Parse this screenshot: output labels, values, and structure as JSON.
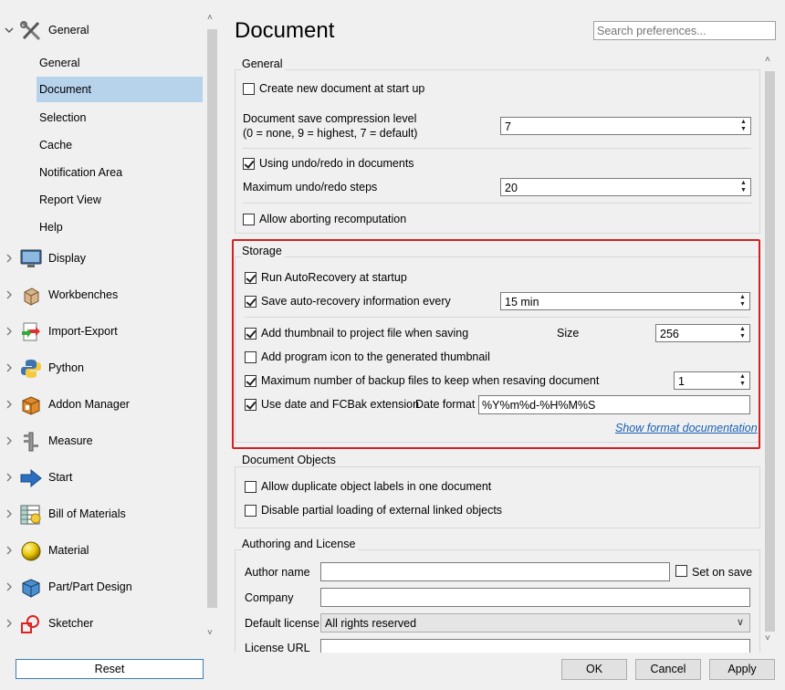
{
  "tree": {
    "top_items": [
      {
        "label": "General",
        "icon": "tools-icon",
        "expanded": true
      },
      {
        "label": "Display",
        "icon": "monitor-icon"
      },
      {
        "label": "Workbenches",
        "icon": "box-icon"
      },
      {
        "label": "Import-Export",
        "icon": "import-export-icon"
      },
      {
        "label": "Python",
        "icon": "python-icon"
      },
      {
        "label": "Addon Manager",
        "icon": "addon-box-icon"
      },
      {
        "label": "Measure",
        "icon": "caliper-icon"
      },
      {
        "label": "Start",
        "icon": "arrow-right-icon"
      },
      {
        "label": "Bill of Materials",
        "icon": "spreadsheet-icon"
      },
      {
        "label": "Material",
        "icon": "sphere-icon"
      },
      {
        "label": "Part/Part Design",
        "icon": "cube-icon"
      },
      {
        "label": "Sketcher",
        "icon": "sketch-icon"
      }
    ],
    "sub_items": [
      "General",
      "Document",
      "Selection",
      "Cache",
      "Notification Area",
      "Report View",
      "Help"
    ],
    "selected_sub": "Document",
    "reset_label": "Reset"
  },
  "page": {
    "title": "Document",
    "search_placeholder": "Search preferences..."
  },
  "general": {
    "title": "General",
    "create_new_doc": {
      "label": "Create new document at start up",
      "checked": false
    },
    "compression_label_1": "Document save compression level",
    "compression_label_2": "(0 = none, 9 = highest, 7 = default)",
    "compression_value": "7",
    "undo_redo": {
      "label": "Using undo/redo in documents",
      "checked": true
    },
    "max_undo_label": "Maximum undo/redo steps",
    "max_undo_value": "20",
    "allow_abort": {
      "label": "Allow aborting recomputation",
      "checked": false
    }
  },
  "storage": {
    "title": "Storage",
    "run_autorecovery": {
      "label": "Run AutoRecovery at startup",
      "checked": true
    },
    "save_autorecovery": {
      "label": "Save auto-recovery information every",
      "checked": true
    },
    "autorecovery_value": "15 min",
    "add_thumbnail": {
      "label": "Add thumbnail to project file when saving",
      "checked": true
    },
    "size_label": "Size",
    "size_value": "256",
    "add_program_icon": {
      "label": "Add program icon to the generated thumbnail",
      "checked": false
    },
    "max_backup": {
      "label": "Maximum number of backup files to keep when resaving document",
      "checked": true
    },
    "max_backup_value": "1",
    "use_date": {
      "label": "Use date and FCBak extension",
      "checked": true
    },
    "date_format_label": "Date format",
    "date_format_value": "%Y%m%d-%H%M%S",
    "show_doc_link": "Show format documentation"
  },
  "doc_objects": {
    "title": "Document Objects",
    "allow_duplicate": {
      "label": "Allow duplicate object labels in one document",
      "checked": false
    },
    "disable_partial": {
      "label": "Disable partial loading of external linked objects",
      "checked": false
    }
  },
  "authoring": {
    "title": "Authoring and License",
    "author_label": "Author name",
    "author_value": "",
    "set_on_save": {
      "label": "Set on save",
      "checked": false
    },
    "company_label": "Company",
    "company_value": "",
    "license_label": "Default license",
    "license_value": "All rights reserved",
    "license_url_label": "License URL"
  },
  "buttons": {
    "ok": "OK",
    "cancel": "Cancel",
    "apply": "Apply"
  },
  "colors": {
    "selection": "#b7d3ec",
    "highlight": "#d42020",
    "link": "#1a5fb4"
  }
}
